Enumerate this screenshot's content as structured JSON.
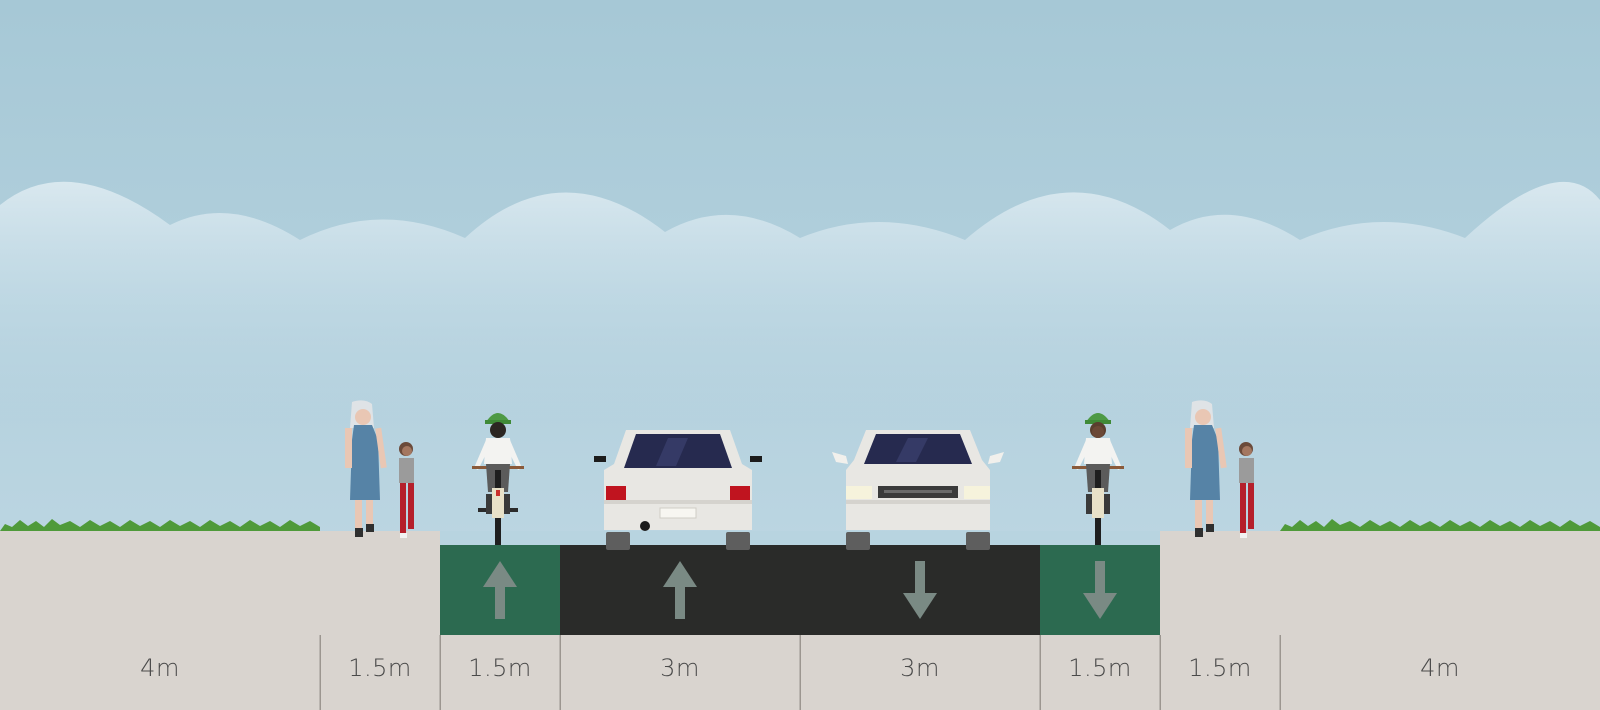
{
  "colors": {
    "sky_top": "#a6c8d6",
    "sky_bottom": "#b8d4e0",
    "cloud": "#d6e6ee",
    "grass": "#4f9a3a",
    "sidewalk": "#d9d4cf",
    "bike_lane": "#2c6a50",
    "travel_lane": "#2a2b29",
    "arrow": "#7a8a84",
    "divider": "#9c9690"
  },
  "segments": [
    {
      "type": "sidewalk-planting",
      "width_label": "4m",
      "direction": null
    },
    {
      "type": "sidewalk",
      "width_label": "1.5m",
      "direction": null
    },
    {
      "type": "bike-lane",
      "width_label": "1.5m",
      "direction": "inbound"
    },
    {
      "type": "drive-lane",
      "width_label": "3m",
      "direction": "inbound"
    },
    {
      "type": "drive-lane",
      "width_label": "3m",
      "direction": "outbound"
    },
    {
      "type": "bike-lane",
      "width_label": "1.5m",
      "direction": "outbound"
    },
    {
      "type": "sidewalk",
      "width_label": "1.5m",
      "direction": null
    },
    {
      "type": "sidewalk-planting",
      "width_label": "4m",
      "direction": null
    }
  ]
}
